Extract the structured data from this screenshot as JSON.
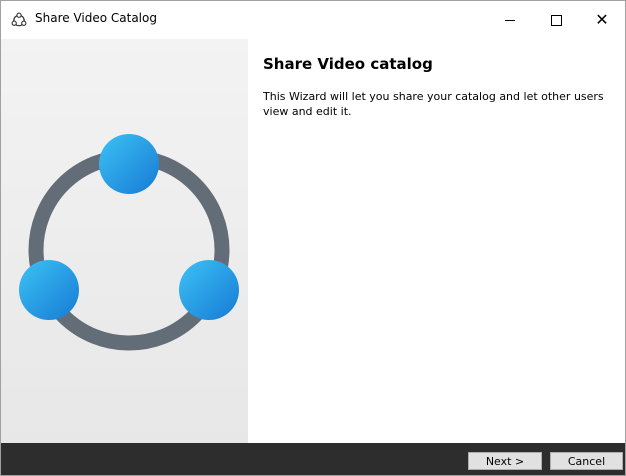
{
  "window": {
    "title": "Share Video Catalog",
    "icon": "share-icon"
  },
  "content": {
    "heading": "Share Video catalog",
    "description": "This Wizard will let you share your catalog and let other users view and edit it."
  },
  "footer": {
    "next_label": "Next >",
    "cancel_label": "Cancel"
  },
  "colors": {
    "ring": "#636d77",
    "node_light": "#35b6f0",
    "node_dark": "#1a7fd6",
    "footer": "#2d2d2d"
  }
}
